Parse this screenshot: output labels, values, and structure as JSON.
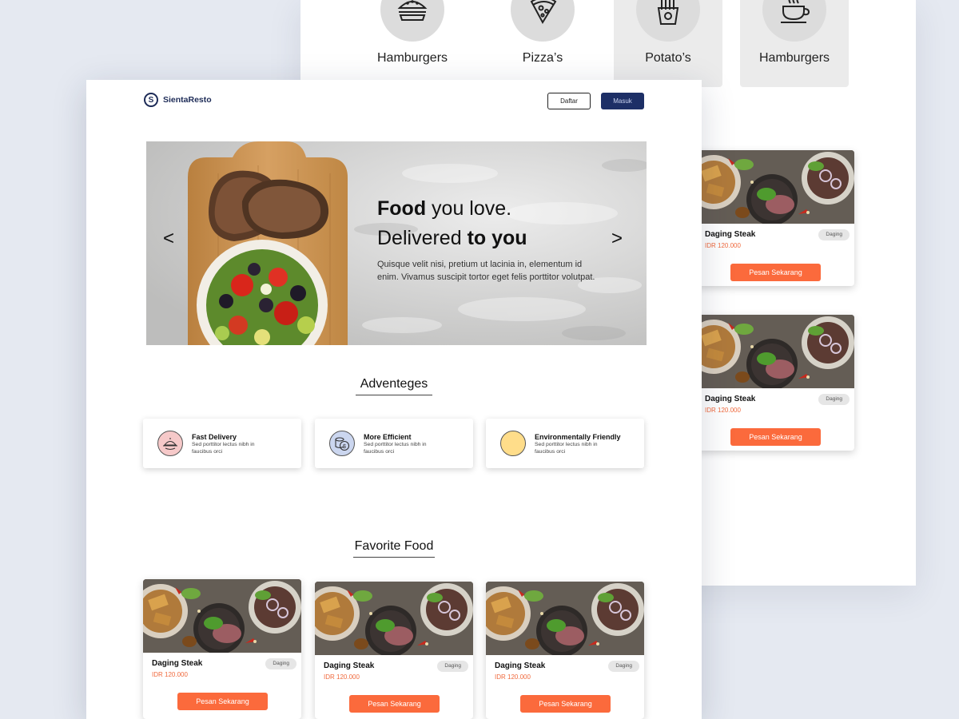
{
  "categories": [
    {
      "label": "Hamburgers",
      "icon": "hamburger-icon"
    },
    {
      "label": "Pizza’s",
      "icon": "pizza-icon"
    },
    {
      "label": "Potato’s",
      "icon": "fries-icon"
    },
    {
      "label": "Hamburgers",
      "icon": "coffee-cup-icon"
    }
  ],
  "header": {
    "logo_letter": "S",
    "brand": "SientaResto",
    "register_label": "Daftar",
    "login_label": "Masuk"
  },
  "hero": {
    "title_bold_1": "Food",
    "title_rest_1": " you love.",
    "title_rest_2": "Delivered ",
    "title_bold_2": "to you",
    "description": "Quisque velit nisi, pretium ut lacinia in, elementum id enim. Vivamus suscipit tortor eget felis porttitor volutpat.",
    "prev_arrow": "<",
    "next_arrow": ">"
  },
  "advantages": {
    "title": "Adventeges",
    "items": [
      {
        "title": "Fast Delivery",
        "description": "Sed porttitor lectus nibh in faucibus orci",
        "icon": "food-tray-icon",
        "color": "#f6c9c9"
      },
      {
        "title": "More Efficient",
        "description": "Sed porttitor lectus nibh in faucibus orci",
        "icon": "coins-icon",
        "color": "#cbd6ef"
      },
      {
        "title": "Environmentally Friendly",
        "description": "Sed porttitor lectus nibh in faucibus orci",
        "icon": "leaf-circle-icon",
        "color": "#ffdd8a"
      }
    ]
  },
  "favorites": {
    "title": "Favorite Food",
    "items": [
      {
        "name": "Daging Steak",
        "price": "IDR 120.000",
        "badge": "Daging",
        "button": "Pesan Sekarang"
      },
      {
        "name": "Daging Steak",
        "price": "IDR 120.000",
        "badge": "Daging",
        "button": "Pesan Sekarang"
      },
      {
        "name": "Daging Steak",
        "price": "IDR 120.000",
        "badge": "Daging",
        "button": "Pesan Sekarang"
      }
    ]
  },
  "back_menu": {
    "items": [
      {
        "name": "Daging Steak",
        "price": "IDR 120.000",
        "badge": "Daging",
        "button": "Pesan Sekarang"
      },
      {
        "name": "Daging Steak",
        "price": "IDR 120.000",
        "badge": "Daging",
        "button": "Pesan Sekarang"
      }
    ]
  },
  "colors": {
    "brand_navy": "#1d2b57",
    "accent_orange": "#fb6a3c",
    "price_orange": "#f06a3e",
    "background": "#e5e9f1"
  }
}
